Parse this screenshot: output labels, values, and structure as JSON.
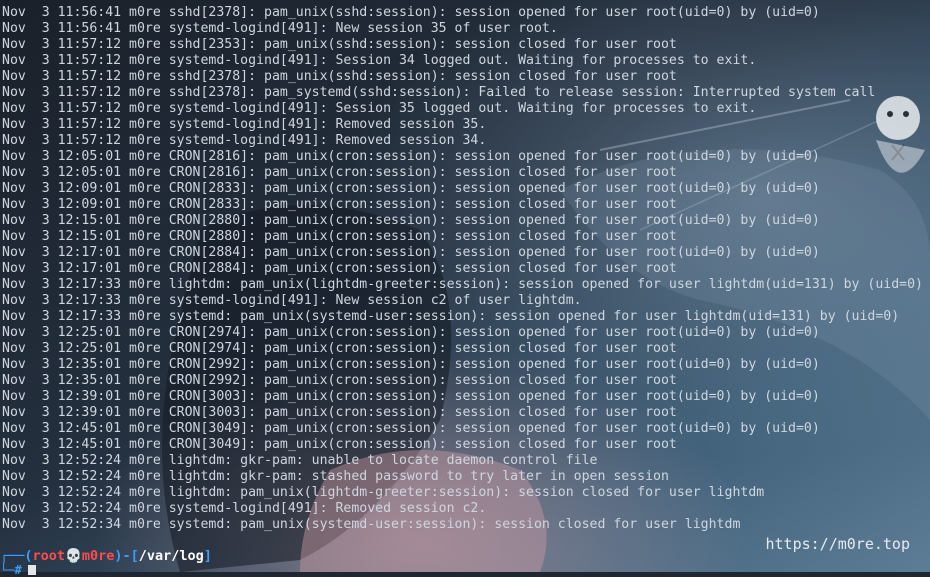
{
  "terminal": {
    "lines": [
      "Nov  3 11:56:41 m0re sshd[2378]: pam_unix(sshd:session): session opened for user root(uid=0) by (uid=0)",
      "Nov  3 11:56:41 m0re systemd-logind[491]: New session 35 of user root.",
      "Nov  3 11:57:12 m0re sshd[2353]: pam_unix(sshd:session): session closed for user root",
      "Nov  3 11:57:12 m0re systemd-logind[491]: Session 34 logged out. Waiting for processes to exit.",
      "Nov  3 11:57:12 m0re sshd[2378]: pam_unix(sshd:session): session closed for user root",
      "Nov  3 11:57:12 m0re sshd[2378]: pam_systemd(sshd:session): Failed to release session: Interrupted system call",
      "Nov  3 11:57:12 m0re systemd-logind[491]: Session 35 logged out. Waiting for processes to exit.",
      "Nov  3 11:57:12 m0re systemd-logind[491]: Removed session 35.",
      "Nov  3 11:57:12 m0re systemd-logind[491]: Removed session 34.",
      "Nov  3 12:05:01 m0re CRON[2816]: pam_unix(cron:session): session opened for user root(uid=0) by (uid=0)",
      "Nov  3 12:05:01 m0re CRON[2816]: pam_unix(cron:session): session closed for user root",
      "Nov  3 12:09:01 m0re CRON[2833]: pam_unix(cron:session): session opened for user root(uid=0) by (uid=0)",
      "Nov  3 12:09:01 m0re CRON[2833]: pam_unix(cron:session): session closed for user root",
      "Nov  3 12:15:01 m0re CRON[2880]: pam_unix(cron:session): session opened for user root(uid=0) by (uid=0)",
      "Nov  3 12:15:01 m0re CRON[2880]: pam_unix(cron:session): session closed for user root",
      "Nov  3 12:17:01 m0re CRON[2884]: pam_unix(cron:session): session opened for user root(uid=0) by (uid=0)",
      "Nov  3 12:17:01 m0re CRON[2884]: pam_unix(cron:session): session closed for user root",
      "Nov  3 12:17:33 m0re lightdm: pam_unix(lightdm-greeter:session): session opened for user lightdm(uid=131) by (uid=0)",
      "Nov  3 12:17:33 m0re systemd-logind[491]: New session c2 of user lightdm.",
      "Nov  3 12:17:33 m0re systemd: pam_unix(systemd-user:session): session opened for user lightdm(uid=131) by (uid=0)",
      "Nov  3 12:25:01 m0re CRON[2974]: pam_unix(cron:session): session opened for user root(uid=0) by (uid=0)",
      "Nov  3 12:25:01 m0re CRON[2974]: pam_unix(cron:session): session closed for user root",
      "Nov  3 12:35:01 m0re CRON[2992]: pam_unix(cron:session): session opened for user root(uid=0) by (uid=0)",
      "Nov  3 12:35:01 m0re CRON[2992]: pam_unix(cron:session): session closed for user root",
      "Nov  3 12:39:01 m0re CRON[3003]: pam_unix(cron:session): session opened for user root(uid=0) by (uid=0)",
      "Nov  3 12:39:01 m0re CRON[3003]: pam_unix(cron:session): session closed for user root",
      "Nov  3 12:45:01 m0re CRON[3049]: pam_unix(cron:session): session opened for user root(uid=0) by (uid=0)",
      "Nov  3 12:45:01 m0re CRON[3049]: pam_unix(cron:session): session closed for user root",
      "Nov  3 12:52:24 m0re lightdm: gkr-pam: unable to locate daemon control file",
      "Nov  3 12:52:24 m0re lightdm: gkr-pam: stashed password to try later in open session",
      "Nov  3 12:52:24 m0re lightdm: pam_unix(lightdm-greeter:session): session closed for user lightdm",
      "Nov  3 12:52:24 m0re systemd-logind[491]: Removed session c2.",
      "Nov  3 12:52:34 m0re systemd: pam_unix(systemd-user:session): session closed for user lightdm"
    ],
    "watermark": "https://m0re.top",
    "prompt": {
      "corner": "┌──(",
      "user": "root",
      "skull": "💀",
      "host": "m0re",
      "dash": ")-[",
      "path": "/var/log",
      "close": "]",
      "hash": "└─#"
    }
  },
  "colors": {
    "background": "#1f2733",
    "text": "#cfd6df",
    "prompt_accent": "#3aa0ff",
    "prompt_user": "#ff4d4d"
  }
}
